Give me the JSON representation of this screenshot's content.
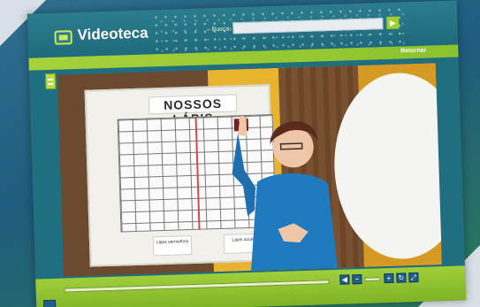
{
  "header": {
    "logo_text": "Videoteca",
    "search_label": "- Busca:",
    "search_value": "",
    "search_go_label": "▶"
  },
  "nav": {
    "return_label": "Retornar"
  },
  "video": {
    "chart_title": "NOSSOS LÁPIS",
    "caption_left": "Lápis vermelhos",
    "caption_right": "Lápis azuis"
  },
  "player": {
    "progress_percent": 0,
    "controls": [
      {
        "name": "prev-control",
        "symbol": "◀"
      },
      {
        "name": "volume-down-control",
        "symbol": "−"
      },
      {
        "name": "volume-up-control",
        "symbol": "+"
      },
      {
        "name": "refresh-control",
        "symbol": "↻"
      },
      {
        "name": "fullscreen-control",
        "symbol": "⤢"
      }
    ]
  }
}
